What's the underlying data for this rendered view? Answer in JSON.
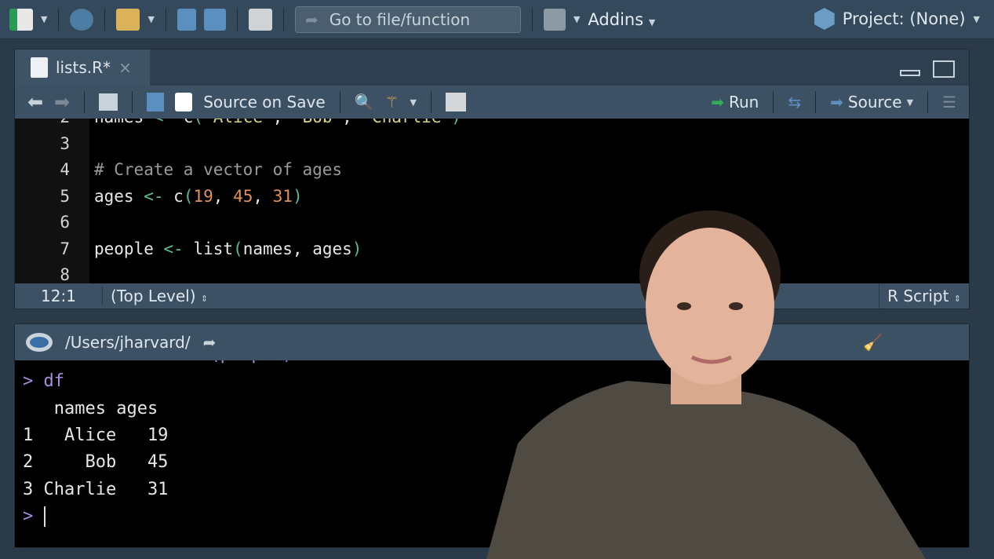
{
  "toolbar": {
    "goto_placeholder": "Go to file/function",
    "addins": "Addins",
    "project": "Project: (None)"
  },
  "editor": {
    "tab_label": "lists.R*",
    "source_on_save": "Source on Save",
    "run": "Run",
    "source": "Source",
    "lines": [
      {
        "n": "2",
        "parts": [
          [
            "names ",
            ""
          ],
          [
            "<-",
            "op"
          ],
          [
            " c",
            ""
          ],
          [
            "(",
            "par"
          ],
          [
            "\"Alice\"",
            "str"
          ],
          [
            ", ",
            ""
          ],
          [
            "\"Bob\"",
            "str"
          ],
          [
            ", ",
            ""
          ],
          [
            "\"Charlie\"",
            "str"
          ],
          [
            ")",
            "par"
          ]
        ]
      },
      {
        "n": "3",
        "parts": []
      },
      {
        "n": "4",
        "parts": [
          [
            "# Create a vector of ages",
            "cm"
          ]
        ]
      },
      {
        "n": "5",
        "parts": [
          [
            "ages ",
            ""
          ],
          [
            "<-",
            "op"
          ],
          [
            " c",
            ""
          ],
          [
            "(",
            "par"
          ],
          [
            "19",
            "num"
          ],
          [
            ", ",
            ""
          ],
          [
            "45",
            "num"
          ],
          [
            ", ",
            ""
          ],
          [
            "31",
            "num"
          ],
          [
            ")",
            "par"
          ]
        ]
      },
      {
        "n": "6",
        "parts": []
      },
      {
        "n": "7",
        "parts": [
          [
            "people ",
            ""
          ],
          [
            "<-",
            "op"
          ],
          [
            " list",
            ""
          ],
          [
            "(",
            "par"
          ],
          [
            "names, ages",
            ""
          ],
          [
            ")",
            "par"
          ]
        ]
      },
      {
        "n": "8",
        "parts": []
      }
    ],
    "cursor_pos": "12:1",
    "scope": "(Top Level)",
    "file_type": "R Script"
  },
  "console": {
    "path": "/Users/jharvard/",
    "lines": [
      {
        "prompt": "> ",
        "text": "df <- data.frame(people)"
      },
      {
        "prompt": "> ",
        "text": "df"
      },
      {
        "prompt": "",
        "text": "   names ages"
      },
      {
        "prompt": "",
        "text": "1   Alice   19"
      },
      {
        "prompt": "",
        "text": "2     Bob   45"
      },
      {
        "prompt": "",
        "text": "3 Charlie   31"
      },
      {
        "prompt": "> ",
        "text": ""
      }
    ]
  }
}
